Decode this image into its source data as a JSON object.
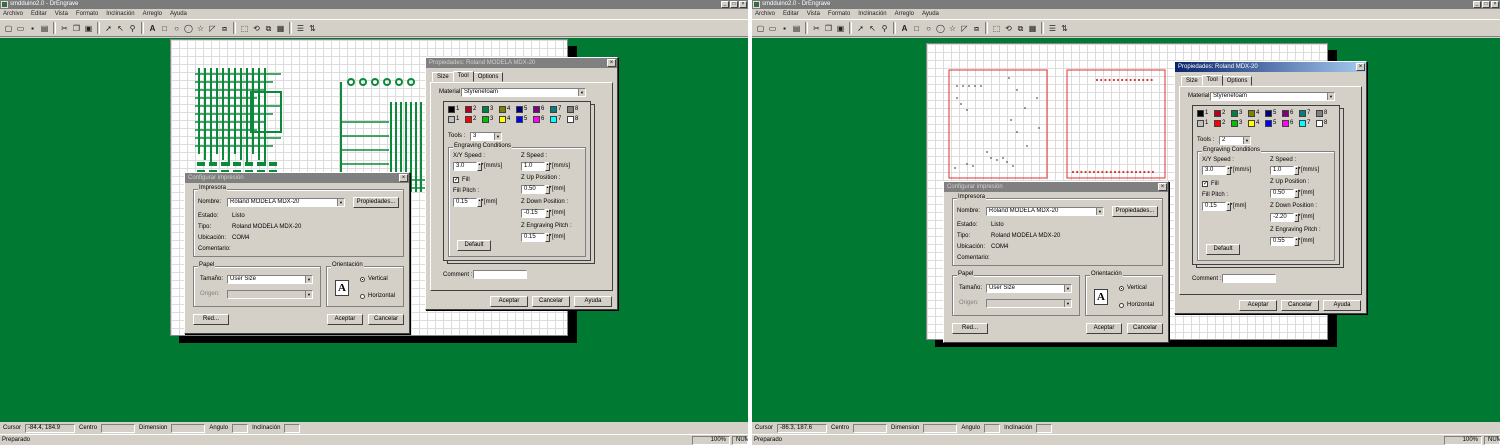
{
  "panes": [
    {
      "id": "left",
      "window_title": "smdduino2.0 - DrEngrave",
      "menu": [
        "Archivo",
        "Editar",
        "Vista",
        "Formato",
        "Inclinación",
        "Arreglo",
        "Ayuda"
      ],
      "status": {
        "cursor_label": "Cursor",
        "cursor_value": "-84.4, 184.9",
        "center_label": "Centro",
        "dimension_label": "Dimension",
        "angle_label": "Angulo",
        "tilt_label": "Inclinación",
        "ready": "Preparado",
        "zoom": "100%",
        "num": "NUM"
      },
      "print_dialog": {
        "title": "Configurar impresión",
        "printer_group": "Impresora",
        "name_label": "Nombre:",
        "name_value": "Roland MODELA MDX-20",
        "properties_button": "Propiedades...",
        "state_label": "Estado:",
        "state_value": "Listo",
        "type_label": "Tipo:",
        "type_value": "Roland MODELA MDX-20",
        "location_label": "Ubicación:",
        "location_value": "COM4",
        "comment_label": "Comentario:",
        "paper_group": "Papel",
        "size_label": "Tamaño:",
        "size_value": "User Size",
        "source_label": "Origen:",
        "orientation_group": "Orientación",
        "portrait": "Vertical",
        "landscape": "Horizontal",
        "network_button": "Red...",
        "ok_button": "Aceptar",
        "cancel_button": "Cancelar"
      },
      "props_dialog": {
        "title": "Propiedades: Roland MODELA MDX-20",
        "tabs": [
          "Size",
          "Tool",
          "Options"
        ],
        "material_label": "Material",
        "material_value": "Styrenefoam",
        "tools_label": "Tools :",
        "tools_value": "3",
        "conditions_group": "Engraving Conditions",
        "xy_speed_label": "X/Y Speed :",
        "xy_speed_value": "3.0",
        "xy_speed_unit": "[mm/s]",
        "fill_label": "Fill",
        "fill_pitch_label": "Fill Pitch :",
        "fill_pitch_value": "0.15",
        "fill_pitch_unit": "[mm]",
        "z_speed_label": "Z Speed :",
        "z_speed_value": "1.0",
        "z_speed_unit": "[mm/s]",
        "z_up_label": "Z Up Position :",
        "z_up_value": "0.50",
        "z_up_unit": "[mm]",
        "z_down_label": "Z Down Position :",
        "z_down_value": "-0.15",
        "z_down_unit": "[mm]",
        "z_pitch_label": "Z Engraving Pitch :",
        "z_pitch_value": "0.15",
        "z_pitch_unit": "[mm]",
        "default_button": "Default",
        "comment_label": "Comment :",
        "ok_button": "Aceptar",
        "cancel_button": "Cancelar",
        "help_button": "Ayuda"
      }
    },
    {
      "id": "right",
      "window_title": "smdduino2.0 - DrEngrave",
      "menu": [
        "Archivo",
        "Editar",
        "Vista",
        "Formato",
        "Inclinación",
        "Arreglo",
        "Ayuda"
      ],
      "status": {
        "cursor_label": "Cursor",
        "cursor_value": "-86.3, 187.6",
        "center_label": "Centro",
        "dimension_label": "Dimension",
        "angle_label": "Angulo",
        "tilt_label": "Inclinación",
        "ready": "Preparado",
        "zoom": "100%",
        "num": "NUM"
      },
      "print_dialog": {
        "title": "Configurar impresión",
        "printer_group": "Impresora",
        "name_label": "Nombre:",
        "name_value": "Roland MODELA MDX-20",
        "properties_button": "Propiedades...",
        "state_label": "Estado:",
        "state_value": "Listo",
        "type_label": "Tipo:",
        "type_value": "Roland MODELA MDX-20",
        "location_label": "Ubicación:",
        "location_value": "COM4",
        "comment_label": "Comentario:",
        "paper_group": "Papel",
        "size_label": "Tamaño:",
        "size_value": "User Size",
        "source_label": "Origen:",
        "orientation_group": "Orientación",
        "portrait": "Vertical",
        "landscape": "Horizontal",
        "network_button": "Red...",
        "ok_button": "Aceptar",
        "cancel_button": "Cancelar"
      },
      "props_dialog": {
        "title": "Propiedades: Roland MDX-20",
        "tabs": [
          "Size",
          "Tool",
          "Options"
        ],
        "material_label": "Material",
        "material_value": "Styrenefoam",
        "tools_label": "Tools :",
        "tools_value": "2",
        "conditions_group": "Engraving Conditions",
        "xy_speed_label": "X/Y Speed :",
        "xy_speed_value": "3.0",
        "xy_speed_unit": "[mm/s]",
        "fill_label": "Fill",
        "fill_pitch_label": "Fill Pitch :",
        "fill_pitch_value": "0.15",
        "fill_pitch_unit": "[mm]",
        "z_speed_label": "Z Speed :",
        "z_speed_value": "1.0",
        "z_speed_unit": "[mm/s]",
        "z_up_label": "Z Up Position :",
        "z_up_value": "0.50",
        "z_up_unit": "[mm]",
        "z_down_label": "Z Down Position :",
        "z_down_value": "-2.20",
        "z_down_unit": "[mm]",
        "z_pitch_label": "Z Engraving Pitch :",
        "z_pitch_value": "0.55",
        "z_pitch_unit": "[mm]",
        "default_button": "Default",
        "comment_label": "Comment :",
        "ok_button": "Aceptar",
        "cancel_button": "Cancelar",
        "help_button": "Ayuda"
      }
    }
  ],
  "tool_colors": [
    {
      "n": "1",
      "c": "#000000"
    },
    {
      "n": "2",
      "c": "#b3001b"
    },
    {
      "n": "3",
      "c": "#008040"
    },
    {
      "n": "4",
      "c": "#808000"
    },
    {
      "n": "5",
      "c": "#000080"
    },
    {
      "n": "6",
      "c": "#800080"
    },
    {
      "n": "7",
      "c": "#008080"
    },
    {
      "n": "8",
      "c": "#808080"
    }
  ],
  "tool_colors_row2": [
    {
      "n": "1",
      "c": "#c0c0c0"
    },
    {
      "n": "2",
      "c": "#ff0000"
    },
    {
      "n": "3",
      "c": "#00c000"
    },
    {
      "n": "4",
      "c": "#ffff00"
    },
    {
      "n": "5",
      "c": "#0000ff"
    },
    {
      "n": "6",
      "c": "#ff00ff"
    },
    {
      "n": "7",
      "c": "#00ffff"
    },
    {
      "n": "8",
      "c": "#ffffff"
    }
  ],
  "colors": {
    "workspace": "#007a33",
    "trace": "#0a8a3a",
    "outline": "#e03030"
  }
}
